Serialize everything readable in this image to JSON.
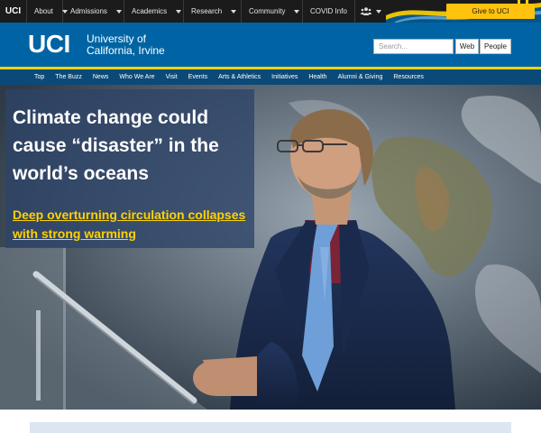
{
  "topbar": {
    "logo": "UCI",
    "items": [
      {
        "label": "About"
      },
      {
        "label": "Admissions"
      },
      {
        "label": "Academics"
      },
      {
        "label": "Research"
      },
      {
        "label": "Community"
      }
    ],
    "covid": "COVID Info",
    "people_icon": "people-icon",
    "give_label": "Give to UCI"
  },
  "header": {
    "logo_text": "UCI",
    "name_line1": "University of",
    "name_line2": "California, Irvine",
    "search_placeholder": "Search...",
    "toggle_web": "Web",
    "toggle_people": "People"
  },
  "nav": {
    "items": [
      "Top",
      "The Buzz",
      "News",
      "Who We Are",
      "Visit",
      "Events",
      "Arts & Athletics",
      "Initiatives",
      "Health",
      "Alumni & Giving",
      "Resources"
    ]
  },
  "hero": {
    "title": "Climate change could cause “disaster” in the world’s oceans",
    "link": "Deep overturning circulation collapses with strong warming"
  },
  "colors": {
    "uci_blue": "#0064a4",
    "uci_gold": "#ffd200",
    "nav_blue": "#0b4a78",
    "topbar": "#1b1b1b"
  }
}
